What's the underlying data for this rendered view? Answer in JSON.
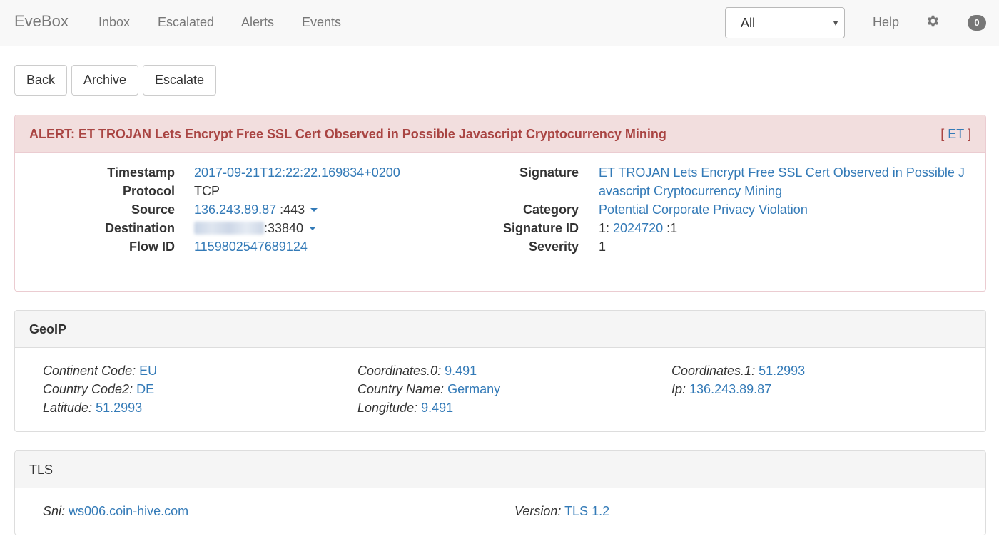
{
  "navbar": {
    "brand": "EveBox",
    "items": [
      "Inbox",
      "Escalated",
      "Alerts",
      "Events"
    ],
    "filter_value": "All",
    "help": "Help",
    "badge_count": "0"
  },
  "actions": {
    "back": "Back",
    "archive": "Archive",
    "escalate": "Escalate"
  },
  "alert": {
    "title": "ALERT: ET TROJAN Lets Encrypt Free SSL Cert Observed in Possible Javascript Cryptocurrency Mining",
    "tag_open": "[",
    "tag": "ET",
    "tag_close": "]",
    "labels": {
      "timestamp": "Timestamp",
      "protocol": "Protocol",
      "source": "Source",
      "destination": "Destination",
      "flow_id": "Flow ID",
      "signature": "Signature",
      "category": "Category",
      "signature_id": "Signature ID",
      "severity": "Severity"
    },
    "timestamp": "2017-09-21T12:22:22.169834+0200",
    "protocol": "TCP",
    "source_ip": "136.243.89.87",
    "source_port": ":443",
    "destination_port": ":33840",
    "flow_id": "1159802547689124",
    "signature_line1": "ET TROJAN Lets Encrypt Free SSL Cert Observed in Possible J",
    "signature_line2": "avascript Cryptocurrency Mining",
    "category": "Potential Corporate Privacy Violation",
    "sig_gid": "1:",
    "sig_id": "2024720",
    "sig_rev": ":1",
    "severity": "1"
  },
  "geoip": {
    "title": "GeoIP",
    "items": [
      {
        "key": "Continent Code:",
        "value": "EU"
      },
      {
        "key": "Country Code2:",
        "value": "DE"
      },
      {
        "key": "Latitude:",
        "value": "51.2993"
      },
      {
        "key": "Coordinates.0:",
        "value": "9.491"
      },
      {
        "key": "Country Name:",
        "value": "Germany"
      },
      {
        "key": "Longitude:",
        "value": "9.491"
      },
      {
        "key": "Coordinates.1:",
        "value": "51.2993"
      },
      {
        "key": "Ip:",
        "value": "136.243.89.87"
      }
    ]
  },
  "tls": {
    "title": "TLS",
    "items": [
      {
        "key": "Sni:",
        "value": "ws006.coin-hive.com"
      },
      {
        "key": "Version:",
        "value": "TLS 1.2"
      }
    ]
  }
}
